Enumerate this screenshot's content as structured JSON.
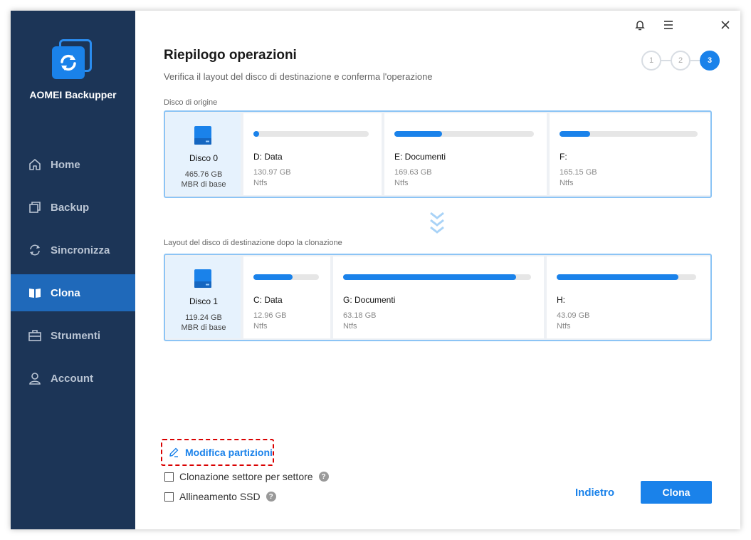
{
  "app": {
    "name": "AOMEI Backupper"
  },
  "sidebar": {
    "items": [
      {
        "label": "Home",
        "icon": "home-icon",
        "active": false
      },
      {
        "label": "Backup",
        "icon": "backup-icon",
        "active": false
      },
      {
        "label": "Sincronizza",
        "icon": "sync-icon",
        "active": false
      },
      {
        "label": "Clona",
        "icon": "clone-icon",
        "active": true
      },
      {
        "label": "Strumenti",
        "icon": "tools-icon",
        "active": false
      },
      {
        "label": "Account",
        "icon": "account-icon",
        "active": false
      }
    ]
  },
  "topbar": {
    "icons": [
      "bell-icon",
      "menu-icon",
      "close-icon"
    ]
  },
  "header": {
    "title": "Riepilogo operazioni",
    "subtitle": "Verifica il layout del disco di destinazione e conferma l'operazione"
  },
  "steps": {
    "labels": [
      "1",
      "2",
      "3"
    ],
    "current": 3
  },
  "source": {
    "label": "Disco di origine",
    "disk": {
      "name": "Disco 0",
      "size": "465.76 GB",
      "type": "MBR di base"
    },
    "partitions": [
      {
        "name": "D: Data",
        "size": "130.97 GB",
        "fs": "Ntfs",
        "used": 0.05
      },
      {
        "name": "E: Documenti",
        "size": "169.63 GB",
        "fs": "Ntfs",
        "used": 0.34
      },
      {
        "name": "F:",
        "size": "165.15 GB",
        "fs": "Ntfs",
        "used": 0.22
      }
    ]
  },
  "destination": {
    "label": "Layout del disco di destinazione dopo la clonazione",
    "disk": {
      "name": "Disco 1",
      "size": "119.24 GB",
      "type": "MBR di base"
    },
    "partitions": [
      {
        "name": "C: Data",
        "size": "12.96 GB",
        "fs": "Ntfs",
        "used": 0.6
      },
      {
        "name": "G: Documenti",
        "size": "63.18 GB",
        "fs": "Ntfs",
        "used": 0.92
      },
      {
        "name": "H:",
        "size": "43.09 GB",
        "fs": "Ntfs",
        "used": 0.87
      }
    ]
  },
  "options": {
    "edit_partitions": "Modifica partizioni",
    "sector_by_sector": "Clonazione settore per settore",
    "ssd_alignment": "Allineamento SSD"
  },
  "buttons": {
    "back": "Indietro",
    "clone": "Clona"
  },
  "colors": {
    "sidebar": "#1c3557",
    "accent": "#1a82ea",
    "active_nav": "#1f69ba",
    "highlight_border": "#d90000"
  }
}
